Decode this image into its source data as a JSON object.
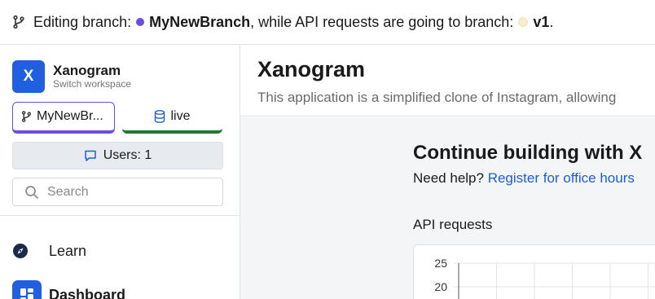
{
  "topbar": {
    "prefix": "Editing branch:",
    "branch": "MyNewBranch",
    "middle": ", while API requests are going to branch:",
    "api_branch": "v1",
    "suffix": ".",
    "branch_color": "#6d4ce0",
    "api_branch_color": "#f6efcf"
  },
  "workspace": {
    "initial": "X",
    "name": "Xanogram",
    "subtitle": "Switch workspace"
  },
  "branch_button": {
    "label": "MyNewBr..."
  },
  "live_button": {
    "label": "live"
  },
  "users_button": {
    "label": "Users: 1"
  },
  "search": {
    "placeholder": "Search",
    "value": ""
  },
  "nav": {
    "learn": {
      "label": "Learn",
      "icon": "compass-icon"
    },
    "dashboard": {
      "label": "Dashboard",
      "icon": "dashboard-icon"
    }
  },
  "main": {
    "title": "Xanogram",
    "description": "This application is a simplified clone of Instagram, allowing",
    "continue_title": "Continue building with X",
    "help_prefix": "Need help?",
    "help_link": "Register for office hours",
    "api_label": "API requests"
  },
  "chart_data": {
    "type": "bar",
    "title": "",
    "y_ticks": [
      "25",
      "20"
    ],
    "ylim": [
      0,
      25
    ],
    "grid": true
  },
  "colors": {
    "accent": "#1f5fe0",
    "branch": "#6d4ce0",
    "live": "#1d7a2e"
  }
}
